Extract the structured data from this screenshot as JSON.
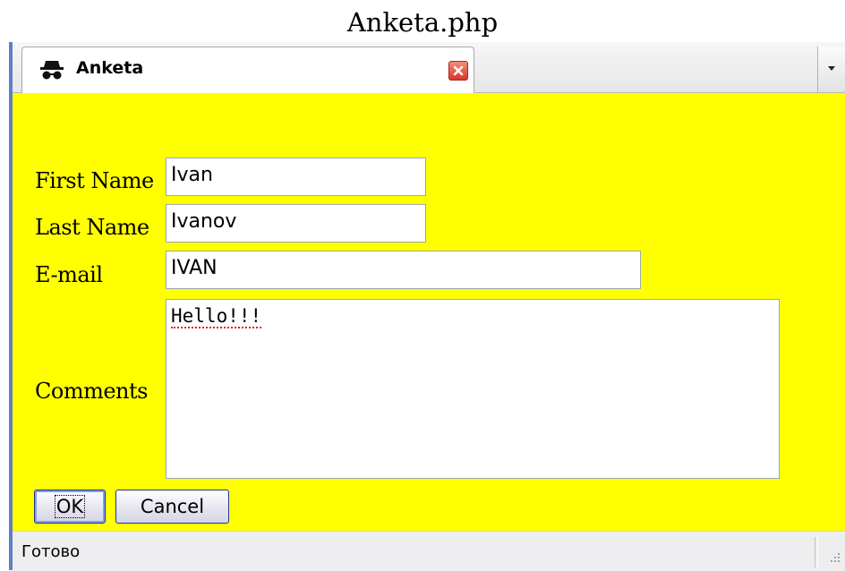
{
  "caption": "Anketa.php",
  "tab": {
    "title": "Anketa",
    "icon": "incognito-icon",
    "close_icon": "close-icon"
  },
  "tab_menu_icon": "chevron-down-icon",
  "colors": {
    "content_bg": "#ffff00",
    "window_border": "#5f7fc6"
  },
  "form": {
    "first_name": {
      "label": "First Name",
      "value": "Ivan"
    },
    "last_name": {
      "label": "Last Name",
      "value": "Ivanov"
    },
    "email": {
      "label": "E-mail",
      "value": "IVAN"
    },
    "comments": {
      "label": "Comments",
      "value": "Hello!!!"
    },
    "ok_label": "OK",
    "cancel_label": "Cancel"
  },
  "status": {
    "text": "Готово"
  }
}
